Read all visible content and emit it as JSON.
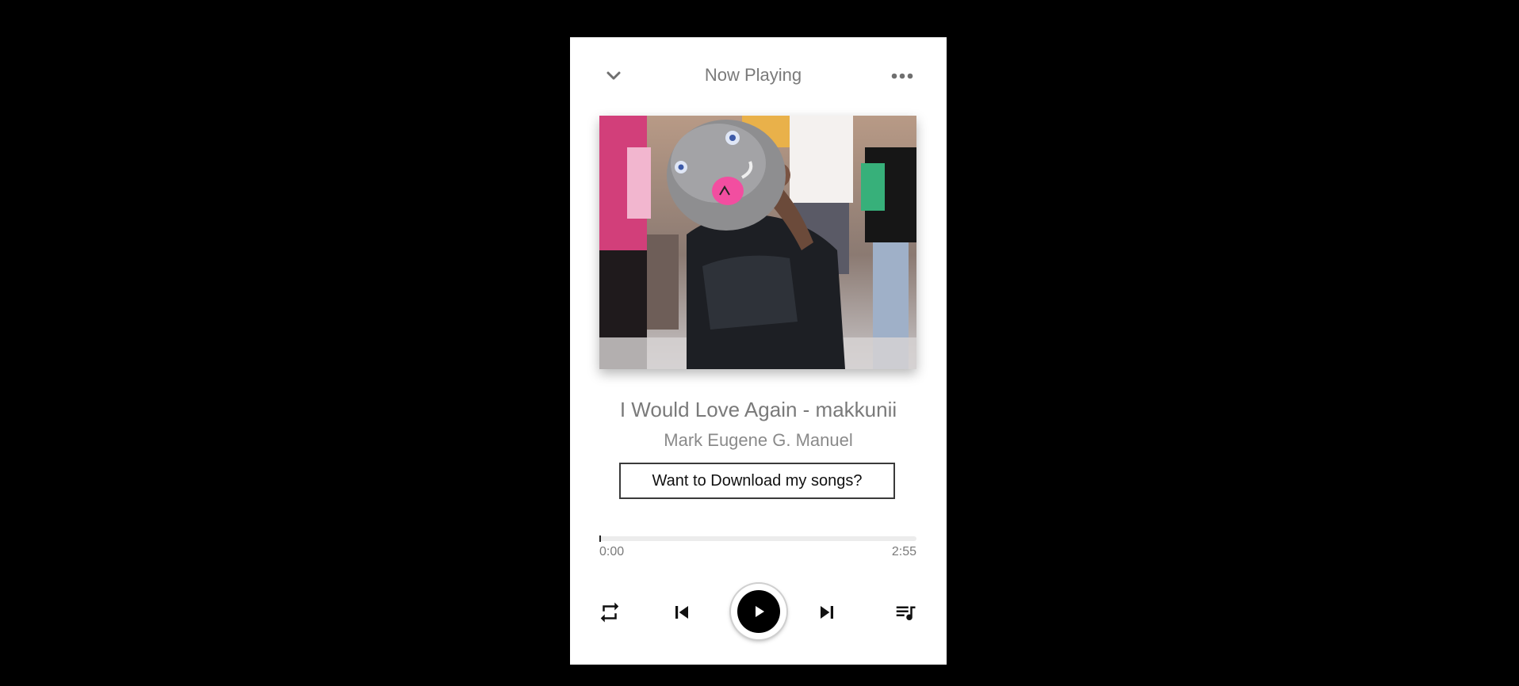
{
  "header": {
    "title": "Now Playing",
    "collapse_icon": "chevron-down-icon",
    "more_icon": "more-horizontal-icon"
  },
  "track": {
    "cover_description_icon": "album-cover-image",
    "title": "I Would Love Again - makkunii",
    "artist": "Mark Eugene G. Manuel",
    "download_label": "Want to Download my songs?"
  },
  "progress": {
    "current_time": "0:00",
    "total_time": "2:55",
    "fraction": 0.0
  },
  "controls": {
    "repeat_icon": "repeat-icon",
    "previous_icon": "skip-previous-icon",
    "play_icon": "play-icon",
    "next_icon": "skip-next-icon",
    "queue_icon": "queue-music-icon"
  },
  "colors": {
    "background": "#000000",
    "panel": "#ffffff",
    "muted_text": "#7a7a7a",
    "accent": "#000000"
  }
}
